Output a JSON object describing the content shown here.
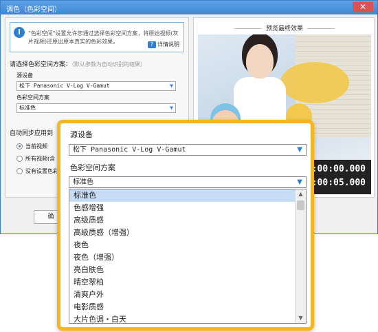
{
  "window": {
    "title": "调色（色彩空间）",
    "close_glyph": "✕"
  },
  "info": {
    "text": "\"色彩空间\"设置允许您通过选择色彩空间方案，将原始视频(灰片视频)还原出原本真实的色彩效果。",
    "help_label": "详情说明"
  },
  "settings": {
    "choose_label": "请选择色彩空间方案：",
    "choose_hint": "（默认参数为自动识别的结果）",
    "source_label": "源设备",
    "source_value": "松下 Panasonic V-Log V-Gamut",
    "scheme_label": "色彩空间方案",
    "scheme_value": "标准色",
    "sync_label": "自动同步应用到",
    "radios": [
      {
        "label": "当前视频",
        "checked": true
      },
      {
        "label": "所有视频(含",
        "checked": false
      },
      {
        "label": "没有设置色彩",
        "checked": false
      }
    ],
    "confirm_label": "确"
  },
  "preview": {
    "title": "预览最终效果",
    "time_current": "00:00:00.000",
    "time_total": "00:00:05.000"
  },
  "popup": {
    "source_label": "源设备",
    "source_value": "松下 Panasonic V-Log V-Gamut",
    "scheme_label": "色彩空间方案",
    "scheme_value": "标准色",
    "options": [
      "标准色",
      "色感增强",
      "高级质感",
      "高级质感（增强）",
      "夜色",
      "夜色（增强）",
      "亮白肤色",
      "晴空翠柏",
      "清爽户外",
      "电影质感",
      "大片色调・白天"
    ],
    "selected_index": 0
  },
  "colors": {
    "accent": "#2e7fd0",
    "popup_border": "#f7b520",
    "selected_bg": "#c7ddf5"
  }
}
